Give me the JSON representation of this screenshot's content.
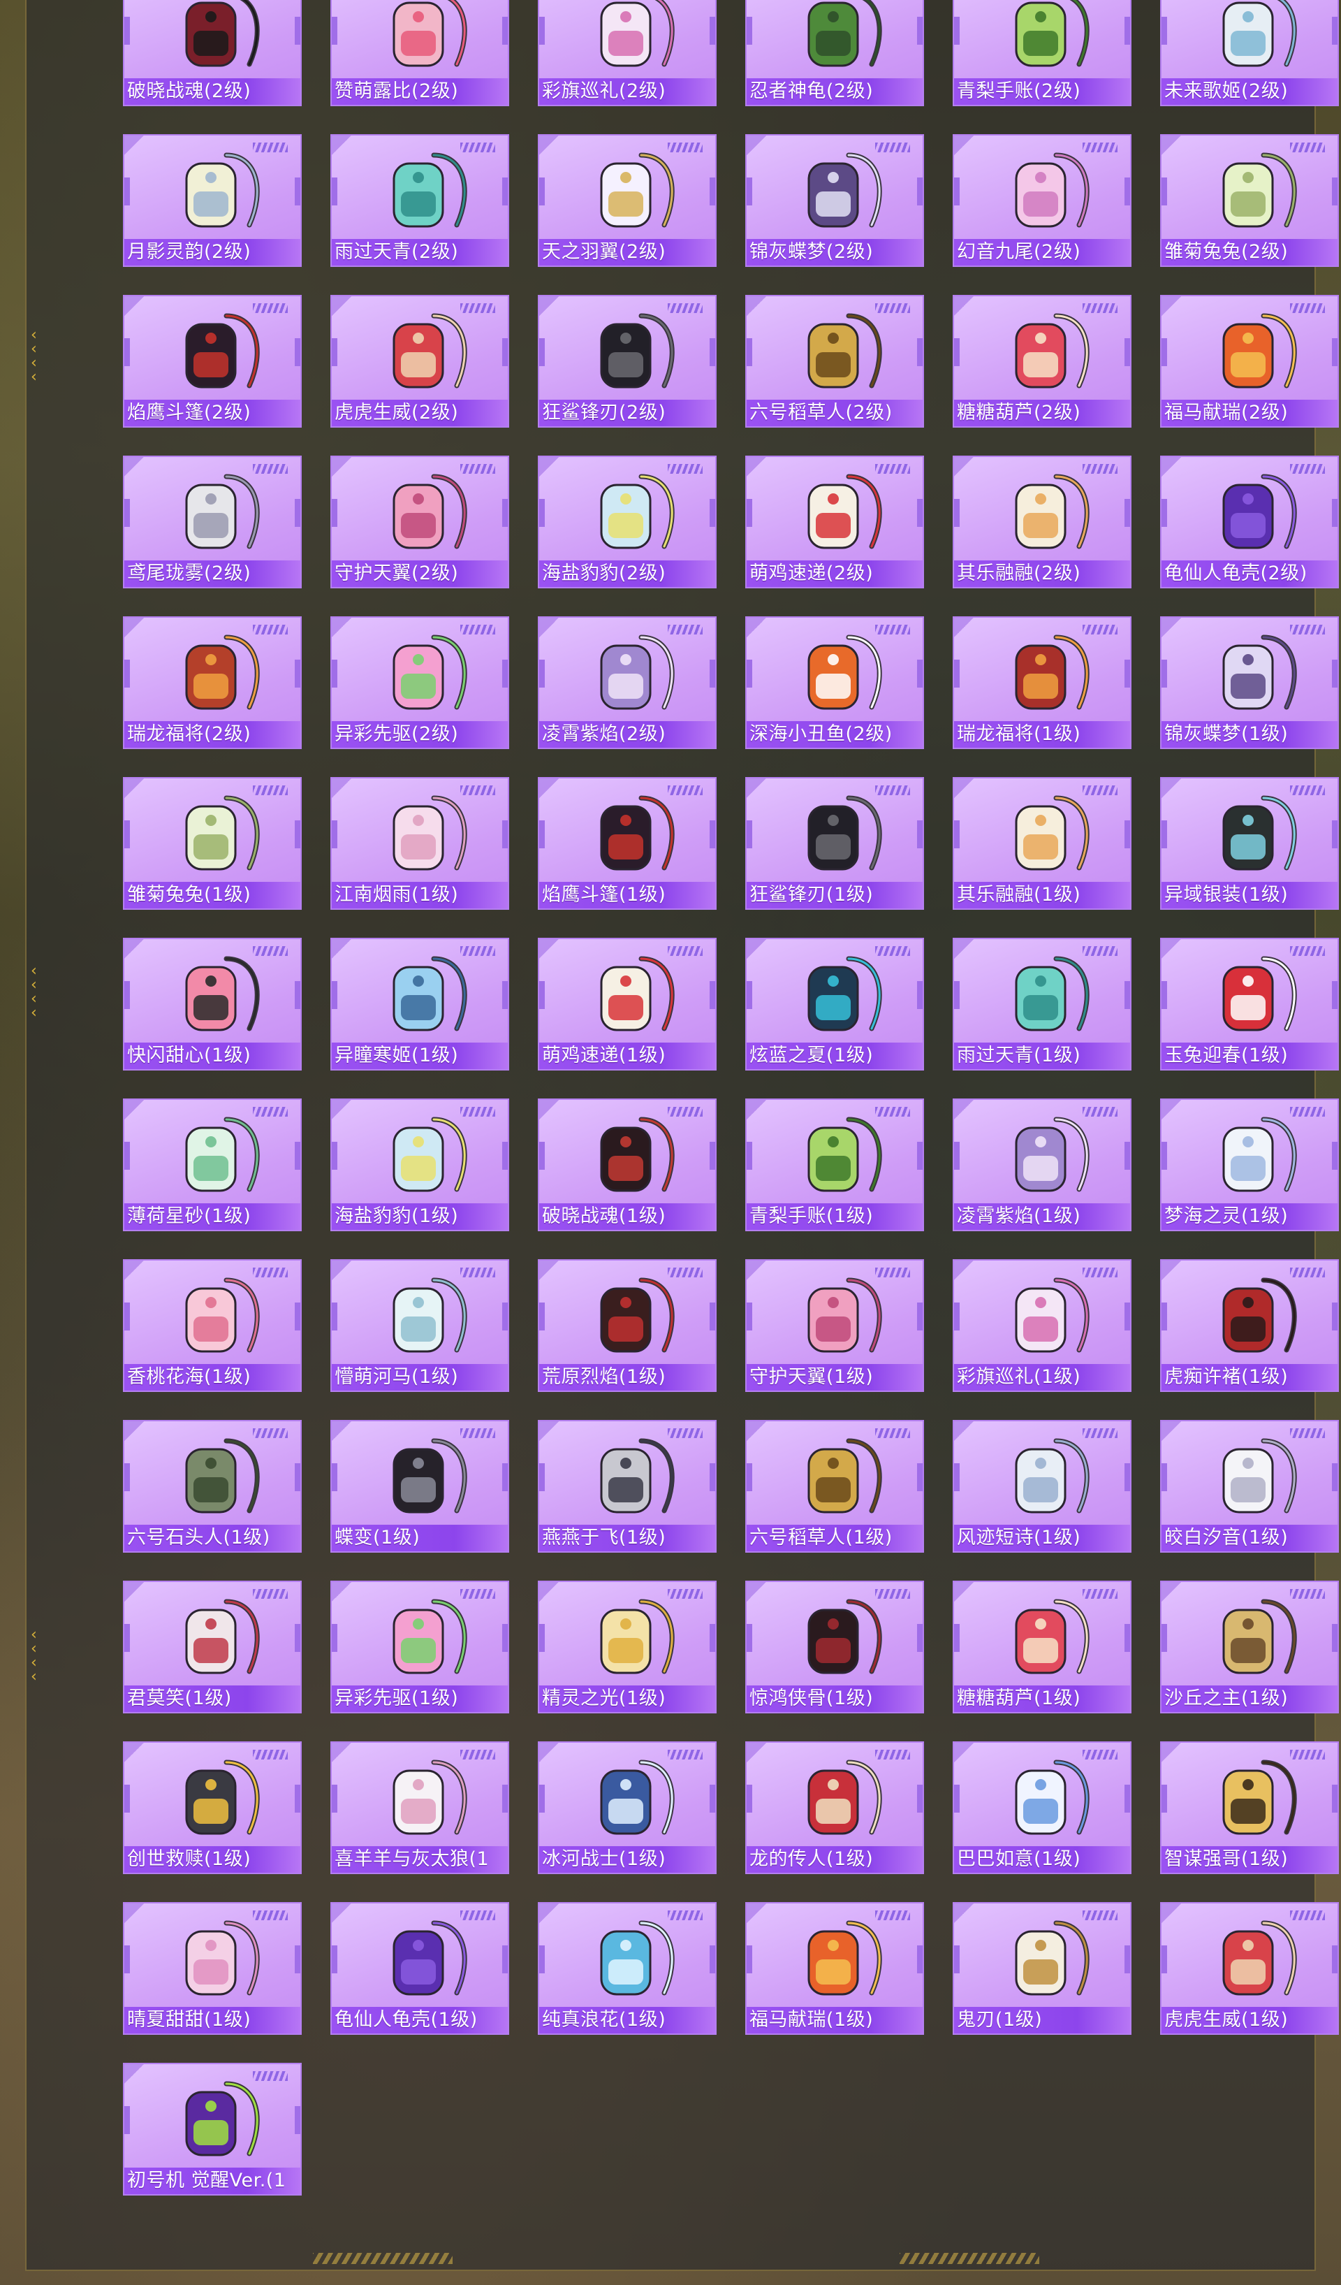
{
  "colors": {
    "card_bg": "#d9a9fb",
    "label_bar": "#9a52f2",
    "frame_border": "#b89a44"
  },
  "items": [
    {
      "label": "破晓战魂(2级)",
      "bag": "#7a1f2a",
      "accent": "#1a1a1a"
    },
    {
      "label": "赞萌露比(2级)",
      "bag": "#f2b6c8",
      "accent": "#e85a7a"
    },
    {
      "label": "彩旗巡礼(2级)",
      "bag": "#f4e6f6",
      "accent": "#d76fb2"
    },
    {
      "label": "忍者神龟(2级)",
      "bag": "#4e8a3a",
      "accent": "#2f4f2a"
    },
    {
      "label": "青梨手账(2级)",
      "bag": "#a8d66a",
      "accent": "#3f7a2a"
    },
    {
      "label": "未来歌姬(2级)",
      "bag": "#e6eef4",
      "accent": "#7fb7d4"
    },
    {
      "label": "月影灵韵(2级)",
      "bag": "#f1f0d6",
      "accent": "#9fb6cf"
    },
    {
      "label": "雨过天青(2级)",
      "bag": "#6fd2c6",
      "accent": "#2f8f8a"
    },
    {
      "label": "天之羽翼(2级)",
      "bag": "#f5f1ff",
      "accent": "#d7b35a"
    },
    {
      "label": "锦灰蝶梦(2级)",
      "bag": "#5c4a86",
      "accent": "#e2e0f5"
    },
    {
      "label": "幻音九尾(2级)",
      "bag": "#f4c7e8",
      "accent": "#d07ac0"
    },
    {
      "label": "雏菊兔兔(2级)",
      "bag": "#e6f2c8",
      "accent": "#9bb36a"
    },
    {
      "label": "焰鹰斗篷(2级)",
      "bag": "#2a1c2a",
      "accent": "#c4322b"
    },
    {
      "label": "虎虎生威(2级)",
      "bag": "#d8434a",
      "accent": "#f0d4b0"
    },
    {
      "label": "狂鲨锋刃(2级)",
      "bag": "#222028",
      "accent": "#6a6a70"
    },
    {
      "label": "六号稻草人(2级)",
      "bag": "#d3a94a",
      "accent": "#6a4a1a"
    },
    {
      "label": "糖糖葫芦(2级)",
      "bag": "#e24b5e",
      "accent": "#f7e2c6"
    },
    {
      "label": "福马献瑞(2级)",
      "bag": "#e8622a",
      "accent": "#f5c050"
    },
    {
      "label": "鸢尾珑雾(2级)",
      "bag": "#e6e6ea",
      "accent": "#9a9ab0"
    },
    {
      "label": "守护天翼(2级)",
      "bag": "#f0a0c0",
      "accent": "#c04a7a"
    },
    {
      "label": "海盐豹豹(2级)",
      "bag": "#cfe9f4",
      "accent": "#e8e070"
    },
    {
      "label": "萌鸡速递(2级)",
      "bag": "#f6f0e4",
      "accent": "#d8353a"
    },
    {
      "label": "其乐融融(2级)",
      "bag": "#f6eedc",
      "accent": "#e9a85a"
    },
    {
      "label": "龟仙人龟壳(2级)",
      "bag": "#5a2fb0",
      "accent": "#8a5ae0"
    },
    {
      "label": "瑞龙福将(2级)",
      "bag": "#b4402a",
      "accent": "#f0a040"
    },
    {
      "label": "异彩先驱(2级)",
      "bag": "#f4a0d0",
      "accent": "#7ad070"
    },
    {
      "label": "凌霄紫焰(2级)",
      "bag": "#a088d0",
      "accent": "#f0e4f8"
    },
    {
      "label": "深海小丑鱼(2级)",
      "bag": "#e86a2a",
      "accent": "#ffffff"
    },
    {
      "label": "瑞龙福将(1级)",
      "bag": "#a8302a",
      "accent": "#f0a040"
    },
    {
      "label": "锦灰蝶梦(1级)",
      "bag": "#e0d8f4",
      "accent": "#5c4a86"
    },
    {
      "label": "雏菊兔兔(1级)",
      "bag": "#eaf2d6",
      "accent": "#9bb36a"
    },
    {
      "label": "江南烟雨(1级)",
      "bag": "#f6dcec",
      "accent": "#e0a0c0"
    },
    {
      "label": "焰鹰斗篷(1级)",
      "bag": "#2a1c2a",
      "accent": "#c4322b"
    },
    {
      "label": "狂鲨锋刃(1级)",
      "bag": "#222028",
      "accent": "#6a6a70"
    },
    {
      "label": "其乐融融(1级)",
      "bag": "#f6eedc",
      "accent": "#e9a85a"
    },
    {
      "label": "异域银装(1级)",
      "bag": "#2a3030",
      "accent": "#7fd0e0"
    },
    {
      "label": "快闪甜心(1级)",
      "bag": "#f28aa8",
      "accent": "#2a2a2a"
    },
    {
      "label": "异瞳寒姬(1级)",
      "bag": "#9ad0f0",
      "accent": "#3a6a9a"
    },
    {
      "label": "萌鸡速递(1级)",
      "bag": "#f6f0e4",
      "accent": "#d8353a"
    },
    {
      "label": "炫蓝之夏(1级)",
      "bag": "#1f3a52",
      "accent": "#36c0d8"
    },
    {
      "label": "雨过天青(1级)",
      "bag": "#6fd2c6",
      "accent": "#2f8f8a"
    },
    {
      "label": "玉兔迎春(1级)",
      "bag": "#d8303a",
      "accent": "#ffffff"
    },
    {
      "label": "薄荷星砂(1级)",
      "bag": "#e0f4e6",
      "accent": "#70c090"
    },
    {
      "label": "海盐豹豹(1级)",
      "bag": "#cfe9f4",
      "accent": "#e8e070"
    },
    {
      "label": "破晓战魂(1级)",
      "bag": "#2a1a1e",
      "accent": "#c23a32"
    },
    {
      "label": "青梨手账(1级)",
      "bag": "#a8d66a",
      "accent": "#3f7a2a"
    },
    {
      "label": "凌霄紫焰(1级)",
      "bag": "#a088d0",
      "accent": "#f0e4f8"
    },
    {
      "label": "梦海之灵(1级)",
      "bag": "#f0f4fa",
      "accent": "#a0b8e0"
    },
    {
      "label": "香桃花海(1级)",
      "bag": "#f8c8d8",
      "accent": "#e07090"
    },
    {
      "label": "懵萌河马(1级)",
      "bag": "#e6f4f6",
      "accent": "#90c0d0"
    },
    {
      "label": "荒原烈焰(1级)",
      "bag": "#3a1e1e",
      "accent": "#c03030"
    },
    {
      "label": "守护天翼(1级)",
      "bag": "#f0a0c0",
      "accent": "#c04a7a"
    },
    {
      "label": "彩旗巡礼(1级)",
      "bag": "#f4e6f6",
      "accent": "#d76fb2"
    },
    {
      "label": "虎痴许褚(1级)",
      "bag": "#b02a2a",
      "accent": "#2a1a1a"
    },
    {
      "label": "六号石头人(1级)",
      "bag": "#7a8a6a",
      "accent": "#3a4a30"
    },
    {
      "label": "蝶变(1级)",
      "bag": "#26222a",
      "accent": "#8a8a98"
    },
    {
      "label": "燕燕于飞(1级)",
      "bag": "#c8c8d0",
      "accent": "#3a3a48"
    },
    {
      "label": "六号稻草人(1级)",
      "bag": "#d3a94a",
      "accent": "#6a4a1a"
    },
    {
      "label": "风迹短诗(1级)",
      "bag": "#e8eef6",
      "accent": "#9ab0d0"
    },
    {
      "label": "皎白汐音(1级)",
      "bag": "#f4f4f8",
      "accent": "#b0b0c8"
    },
    {
      "label": "君莫笑(1级)",
      "bag": "#f0e6ea",
      "accent": "#c03a4a"
    },
    {
      "label": "异彩先驱(1级)",
      "bag": "#f4a0d0",
      "accent": "#7ad070"
    },
    {
      "label": "精灵之光(1级)",
      "bag": "#f4e2a8",
      "accent": "#e0b040"
    },
    {
      "label": "惊鸿侠骨(1级)",
      "bag": "#2a1a1e",
      "accent": "#a02a30"
    },
    {
      "label": "糖糖葫芦(1级)",
      "bag": "#e24b5e",
      "accent": "#f7e2c6"
    },
    {
      "label": "沙丘之主(1级)",
      "bag": "#d8b870",
      "accent": "#6a4a2a"
    },
    {
      "label": "创世救赎(1级)",
      "bag": "#3a3a42",
      "accent": "#f0c040"
    },
    {
      "label": "喜羊羊与灰太狼(1",
      "bag": "#f6f2f6",
      "accent": "#e0a0c0"
    },
    {
      "label": "冰河战士(1级)",
      "bag": "#3a5aa0",
      "accent": "#e0f0ff"
    },
    {
      "label": "龙的传人(1级)",
      "bag": "#c8303a",
      "accent": "#f0e0c0"
    },
    {
      "label": "巴巴如意(1级)",
      "bag": "#f0f4ff",
      "accent": "#6a9ae0"
    },
    {
      "label": "智谋强哥(1级)",
      "bag": "#e8c060",
      "accent": "#3a2a1a"
    },
    {
      "label": "晴夏甜甜(1级)",
      "bag": "#f4d0e6",
      "accent": "#e090c0"
    },
    {
      "label": "龟仙人龟壳(1级)",
      "bag": "#5a2fb0",
      "accent": "#8a5ae0"
    },
    {
      "label": "纯真浪花(1级)",
      "bag": "#5ab8e0",
      "accent": "#e0f4ff"
    },
    {
      "label": "福马献瑞(1级)",
      "bag": "#e8622a",
      "accent": "#f5c050"
    },
    {
      "label": "鬼刃(1级)",
      "bag": "#f4eee0",
      "accent": "#c09040"
    },
    {
      "label": "虎虎生威(1级)",
      "bag": "#d8434a",
      "accent": "#f0d4b0"
    },
    {
      "label": "初号机 觉醒Ver.(1",
      "bag": "#5a2aa0",
      "accent": "#a0e040"
    }
  ]
}
